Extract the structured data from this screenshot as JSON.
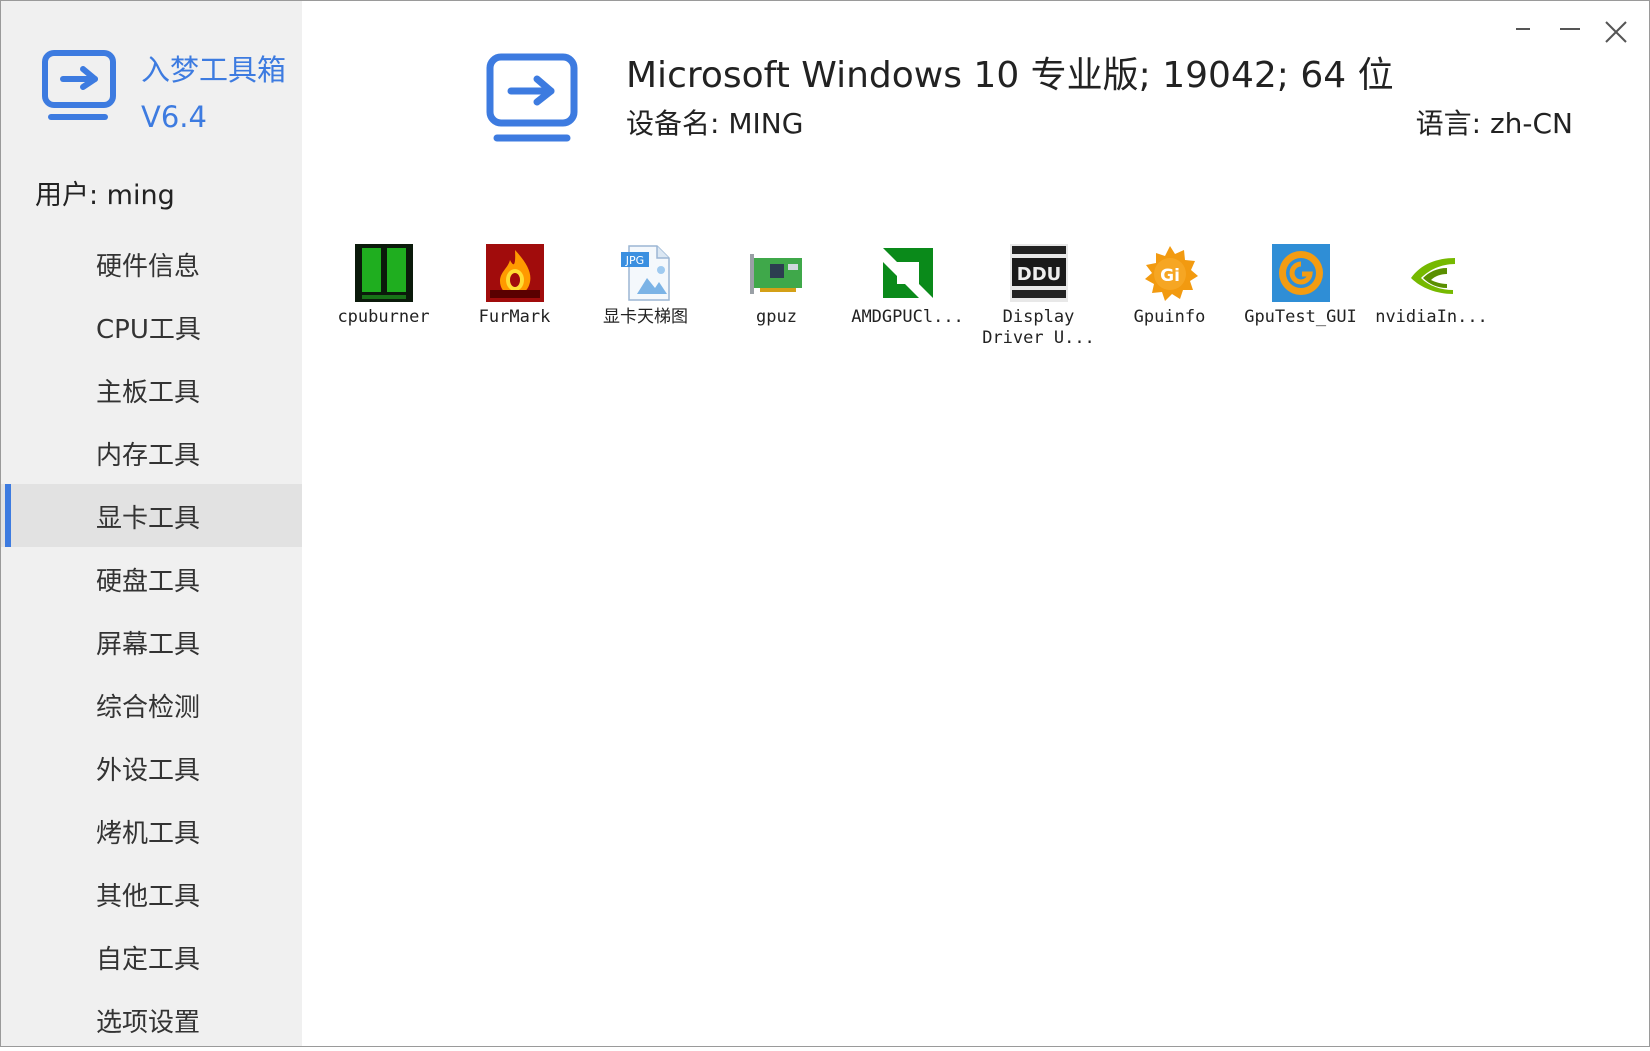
{
  "window": {
    "minimize_label": "",
    "maximize_label": "",
    "close_label": ""
  },
  "sidebar": {
    "app_name": "入梦工具箱",
    "version": "V6.4",
    "user": "用户: ming",
    "items": [
      {
        "label": "硬件信息"
      },
      {
        "label": "CPU工具"
      },
      {
        "label": "主板工具"
      },
      {
        "label": "内存工具"
      },
      {
        "label": "显卡工具",
        "active": true
      },
      {
        "label": "硬盘工具"
      },
      {
        "label": "屏幕工具"
      },
      {
        "label": "综合检测"
      },
      {
        "label": "外设工具"
      },
      {
        "label": "烤机工具"
      },
      {
        "label": "其他工具"
      },
      {
        "label": "自定工具"
      },
      {
        "label": "选项设置"
      }
    ]
  },
  "header": {
    "os": "Microsoft Windows 10 专业版; 19042; 64 位",
    "device": "设备名: MING",
    "language": "语言: zh-CN"
  },
  "tools": [
    {
      "label": "cpuburner",
      "icon": "cpuburner-icon"
    },
    {
      "label": "FurMark",
      "icon": "furmark-icon"
    },
    {
      "label": "显卡天梯图",
      "icon": "jpg-image-icon"
    },
    {
      "label": "gpuz",
      "icon": "gpuz-icon"
    },
    {
      "label": "AMDGPUCl...",
      "icon": "amd-icon"
    },
    {
      "label": "Display\nDriver U...",
      "icon": "ddu-icon"
    },
    {
      "label": "Gpuinfo",
      "icon": "gpuinfo-icon"
    },
    {
      "label": "GpuTest_GUI",
      "icon": "gputest-icon"
    },
    {
      "label": "nvidiaIn...",
      "icon": "nvidia-icon"
    }
  ],
  "colors": {
    "accent": "#3d7be0",
    "sidebar_bg": "#f0f0f0",
    "active_bg": "#e2e2e2"
  }
}
